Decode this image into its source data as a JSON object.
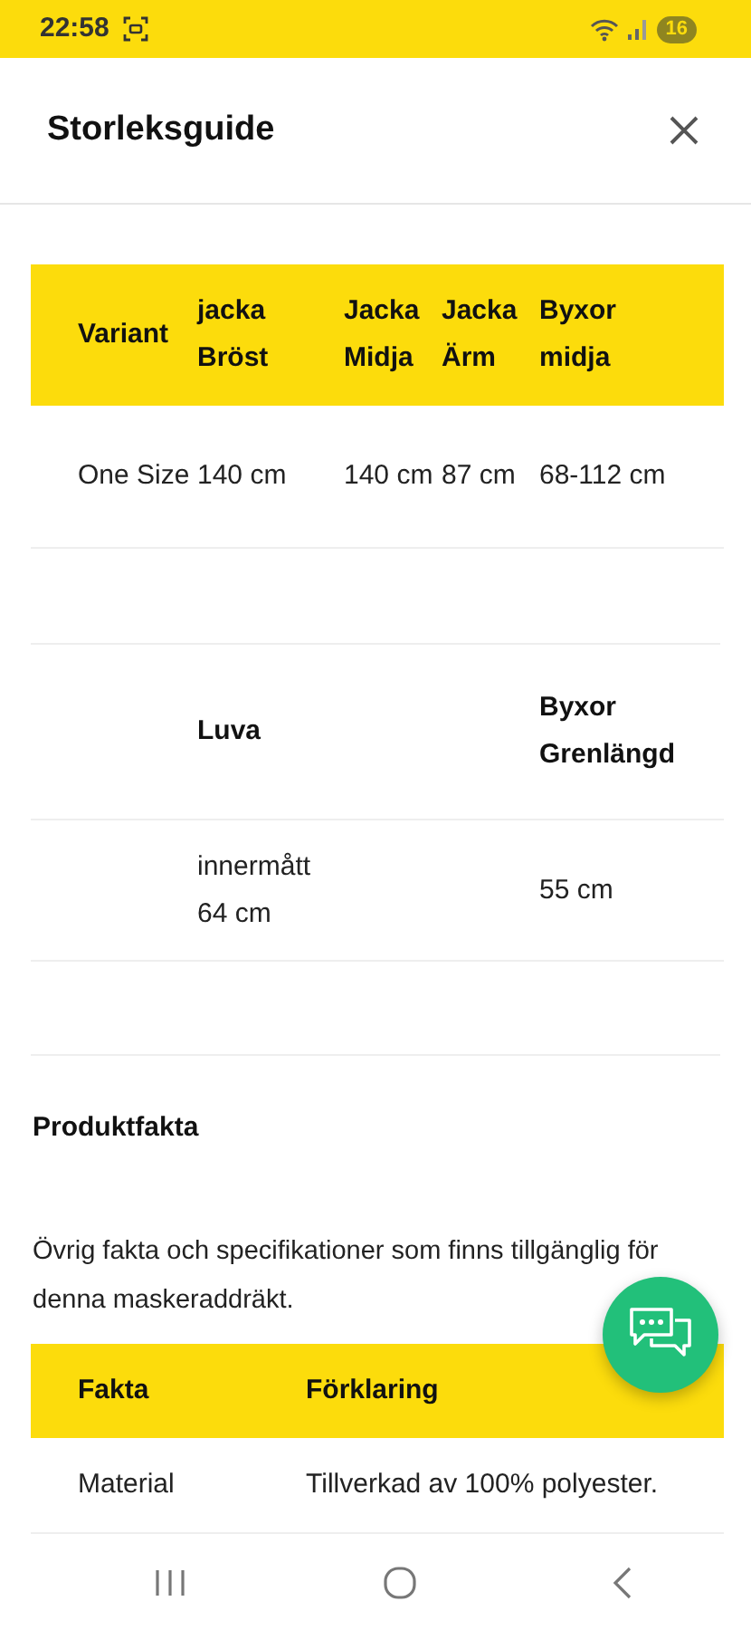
{
  "status_bar": {
    "time": "22:58",
    "battery": "16"
  },
  "dialog": {
    "title": "Storleksguide"
  },
  "size_table": {
    "columns": [
      "Variant",
      "jacka Bröst",
      "Jacka Midja",
      "Jacka Ärm",
      "Byxor midja"
    ],
    "rows": [
      [
        "One Size",
        "140 cm",
        "140 cm",
        "87 cm",
        "68-112 cm"
      ]
    ]
  },
  "extra_table": {
    "columns": [
      null,
      "Luva",
      null,
      null,
      "Byxor Grenlängd"
    ],
    "rows": [
      [
        null,
        "innermått 64 cm",
        null,
        null,
        "55 cm"
      ]
    ]
  },
  "facts": {
    "heading": "Produktfakta",
    "description": "Övrig fakta och specifikationer som finns tillgänglig för denna maskeraddräkt.",
    "columns": [
      "Fakta",
      "Förklaring"
    ],
    "rows": [
      [
        "Material",
        "Tillverkad av 100% polyester."
      ]
    ]
  }
}
